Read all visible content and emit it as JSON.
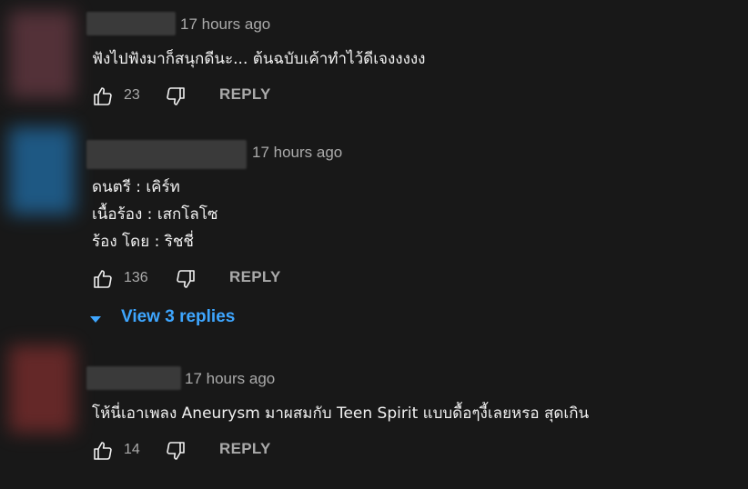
{
  "comments": [
    {
      "time": "17 hours ago",
      "lines": [
        "ฟังไปฟังมาก็สนุกดีนะ... ต้นฉบับเค้าทำไว้ดีเจงงงงง"
      ],
      "likes": "23",
      "reply_label": "REPLY",
      "avatar_color": "#6b3a45"
    },
    {
      "time": "17 hours ago",
      "lines": [
        "ดนตรี    : เคิร์ท",
        "เนื้อร้อง : เสกโลโซ",
        "ร้อง โดย  : ริชชี่"
      ],
      "likes": "136",
      "reply_label": "REPLY",
      "avatar_color": "#2f6f9e",
      "view_replies": "View 3 replies"
    },
    {
      "time": "17 hours ago",
      "lines": [
        "โห้นี่เอาเพลง Aneurysm มาผสมกับ Teen Spirit แบบดื้อๆงี้เลยหรอ สุดเกิน"
      ],
      "likes": "14",
      "reply_label": "REPLY",
      "avatar_color": "#7a2e2e"
    }
  ]
}
